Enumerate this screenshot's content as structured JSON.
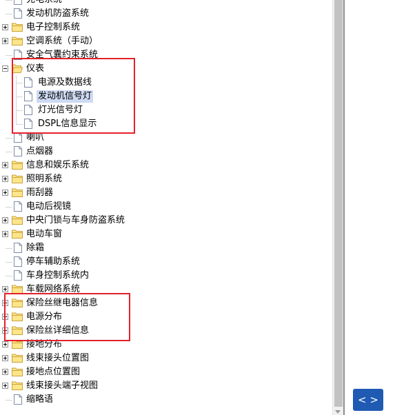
{
  "tree": {
    "items": [
      {
        "label": "充电系统",
        "type": "page",
        "level": 0,
        "expanded": false,
        "selected": false,
        "icon": "page-icon"
      },
      {
        "label": "发动机防盗系统",
        "type": "page",
        "level": 0,
        "expanded": false,
        "selected": false,
        "icon": "page-icon"
      },
      {
        "label": "电子控制系统",
        "type": "folder",
        "level": 0,
        "expanded": false,
        "selected": false,
        "icon": "folder-icon"
      },
      {
        "label": "空调系统（手动）",
        "type": "folder",
        "level": 0,
        "expanded": false,
        "selected": false,
        "icon": "folder-icon"
      },
      {
        "label": "安全气囊约束系统",
        "type": "page",
        "level": 0,
        "expanded": false,
        "selected": false,
        "icon": "page-icon"
      },
      {
        "label": "仪表",
        "type": "folder",
        "level": 0,
        "expanded": true,
        "selected": false,
        "icon": "folder-open-icon"
      },
      {
        "label": "电源及数据线",
        "type": "page",
        "level": 1,
        "expanded": false,
        "selected": false,
        "icon": "page-icon"
      },
      {
        "label": "发动机信号灯",
        "type": "page",
        "level": 1,
        "expanded": false,
        "selected": true,
        "icon": "page-icon"
      },
      {
        "label": "灯光信号灯",
        "type": "page",
        "level": 1,
        "expanded": false,
        "selected": false,
        "icon": "page-icon"
      },
      {
        "label": "DSPL信息显示",
        "type": "page",
        "level": 1,
        "expanded": false,
        "selected": false,
        "icon": "page-icon"
      },
      {
        "label": "喇叭",
        "type": "page",
        "level": 0,
        "expanded": false,
        "selected": false,
        "icon": "page-icon"
      },
      {
        "label": "点烟器",
        "type": "page",
        "level": 0,
        "expanded": false,
        "selected": false,
        "icon": "page-icon"
      },
      {
        "label": "信息和娱乐系统",
        "type": "folder",
        "level": 0,
        "expanded": false,
        "selected": false,
        "icon": "folder-icon"
      },
      {
        "label": "照明系统",
        "type": "folder",
        "level": 0,
        "expanded": false,
        "selected": false,
        "icon": "folder-icon"
      },
      {
        "label": "雨刮器",
        "type": "folder",
        "level": 0,
        "expanded": false,
        "selected": false,
        "icon": "folder-icon"
      },
      {
        "label": "电动后视镜",
        "type": "page",
        "level": 0,
        "expanded": false,
        "selected": false,
        "icon": "page-icon"
      },
      {
        "label": "中央门锁与车身防盗系统",
        "type": "folder",
        "level": 0,
        "expanded": false,
        "selected": false,
        "icon": "folder-icon"
      },
      {
        "label": "电动车窗",
        "type": "folder",
        "level": 0,
        "expanded": false,
        "selected": false,
        "icon": "folder-icon"
      },
      {
        "label": "除霜",
        "type": "page",
        "level": 0,
        "expanded": false,
        "selected": false,
        "icon": "page-icon"
      },
      {
        "label": "停车辅助系统",
        "type": "page",
        "level": 0,
        "expanded": false,
        "selected": false,
        "icon": "page-icon"
      },
      {
        "label": "车身控制系统内",
        "type": "page",
        "level": 0,
        "expanded": false,
        "selected": false,
        "icon": "page-icon"
      },
      {
        "label": "车载网络系统",
        "type": "folder",
        "level": 0,
        "expanded": false,
        "selected": false,
        "icon": "folder-icon"
      },
      {
        "label": "保险丝继电器信息",
        "type": "folder",
        "level": 0,
        "expanded": false,
        "selected": false,
        "icon": "folder-icon"
      },
      {
        "label": "电源分布",
        "type": "folder",
        "level": 0,
        "expanded": false,
        "selected": false,
        "icon": "folder-icon"
      },
      {
        "label": "保险丝详细信息",
        "type": "folder",
        "level": 0,
        "expanded": false,
        "selected": false,
        "icon": "folder-icon"
      },
      {
        "label": "接地分布",
        "type": "folder",
        "level": 0,
        "expanded": false,
        "selected": false,
        "icon": "folder-icon"
      },
      {
        "label": "线束接头位置图",
        "type": "folder",
        "level": 0,
        "expanded": false,
        "selected": false,
        "icon": "folder-icon"
      },
      {
        "label": "接地点位置图",
        "type": "folder",
        "level": 0,
        "expanded": false,
        "selected": false,
        "icon": "folder-icon"
      },
      {
        "label": "线束接头端子视图",
        "type": "folder",
        "level": 0,
        "expanded": false,
        "selected": false,
        "icon": "folder-icon"
      },
      {
        "label": "缩略语",
        "type": "page",
        "level": 0,
        "expanded": false,
        "selected": false,
        "icon": "page-icon"
      }
    ]
  },
  "nav_button": {
    "label": "< >"
  },
  "colors": {
    "highlight_border": "#e3202b",
    "selection_bg": "#cddaf2",
    "folder_fill": "#fce58a",
    "folder_stroke": "#c9a23c",
    "button_bg": "#1f5ab3"
  }
}
